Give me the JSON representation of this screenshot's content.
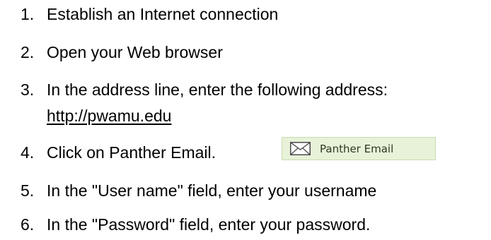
{
  "steps": [
    {
      "number": "1.",
      "text": "Establish an Internet connection"
    },
    {
      "number": "2.",
      "text": "Open your Web browser"
    },
    {
      "number": "3.",
      "text": "In the address line, enter the following address:",
      "link": "http://pwamu.edu"
    },
    {
      "number": "4.",
      "text": "Click on Panther Email."
    },
    {
      "number": "5.",
      "text": "In the \"User name\" field, enter your username"
    },
    {
      "number": "6.",
      "text": "In the \"Password\" field, enter your password."
    }
  ],
  "panther_email_button": {
    "icon": "envelope-icon",
    "label": "Panther Email"
  }
}
